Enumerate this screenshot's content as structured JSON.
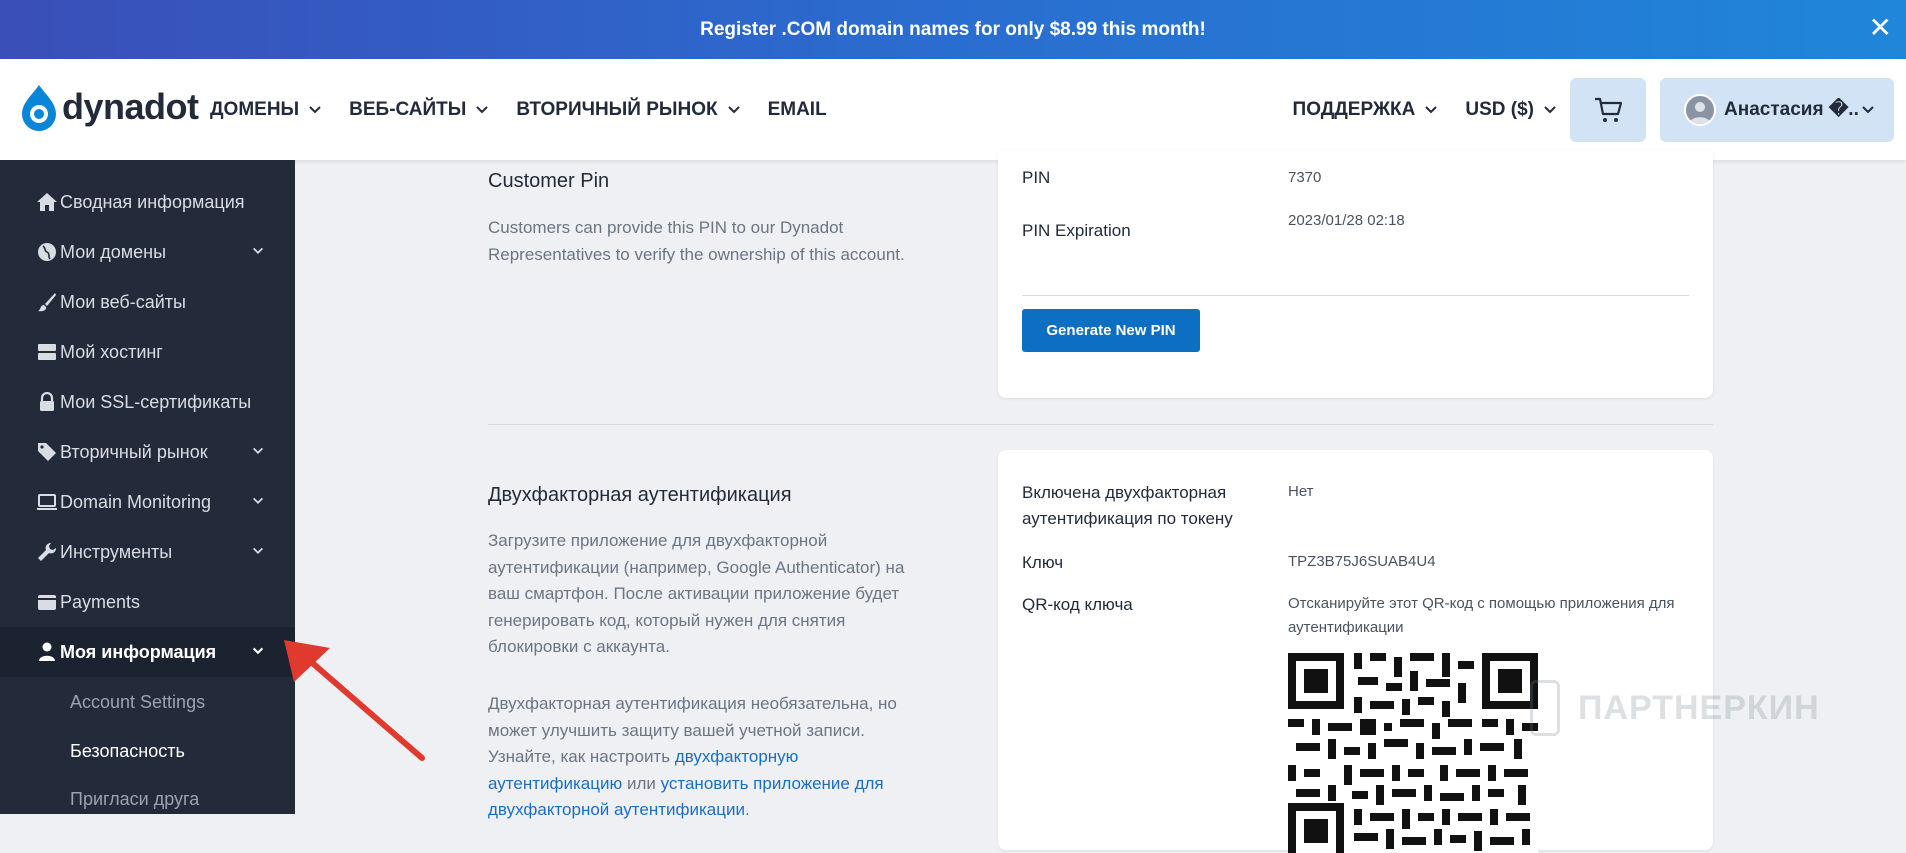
{
  "promo": {
    "text": "Register .COM domain names for only $8.99 this month!",
    "close": "✕"
  },
  "logo": {
    "text": "dynadot",
    "color": "#0a86d8"
  },
  "nav": {
    "items": [
      {
        "label": "ДОМЕНЫ",
        "dropdown": true
      },
      {
        "label": "ВЕБ-САЙТЫ",
        "dropdown": true
      },
      {
        "label": "ВТОРИЧНЫЙ РЫНОК",
        "dropdown": true
      },
      {
        "label": "EMAIL",
        "dropdown": false
      }
    ],
    "support": "ПОДДЕРЖКА",
    "currency": "USD ($)",
    "user": "Анастасия �..."
  },
  "sidebar": {
    "items": [
      {
        "label": "Сводная информация",
        "icon": "home-icon"
      },
      {
        "label": "Мои домены",
        "icon": "globe-icon"
      },
      {
        "label": "Мои веб-сайты",
        "icon": "brush-icon"
      },
      {
        "label": "Мой хостинг",
        "icon": "server-icon"
      },
      {
        "label": "Мои SSL-сертификаты",
        "icon": "lock-icon"
      },
      {
        "label": "Вторичный рынок",
        "icon": "tag-icon"
      },
      {
        "label": "Domain Monitoring",
        "icon": "laptop-icon"
      },
      {
        "label": "Инструменты",
        "icon": "wrench-icon"
      },
      {
        "label": "Payments",
        "icon": "wallet-icon"
      },
      {
        "label": "Моя информация",
        "icon": "user-icon"
      }
    ],
    "sub": [
      "Account Settings",
      "Безопасность",
      "Пригласи друга"
    ]
  },
  "pin": {
    "title": "Customer Pin",
    "desc": "Customers can provide this PIN to our Dynadot Representatives to verify the ownership of this account.",
    "pin_label": "PIN",
    "pin_value": "7370",
    "exp_label": "PIN Expiration",
    "exp_value": "2023/01/28 02:18",
    "button": "Generate New PIN"
  },
  "twofa": {
    "title": "Двухфакторная аутентификация",
    "desc1": "Загрузите приложение для двухфакторной аутентификации (например, Google Authenticator) на ваш смартфон. После активации приложение будет генерировать код, который нужен для снятия блокировки с аккаунта.",
    "desc2_a": "Двухфакторная аутентификация необязательна, но может улучшить защиту вашей учетной записи. Узнайте, как настроить ",
    "desc2_link1": "двухфакторную аутентификацию",
    "desc2_b": " или ",
    "desc2_link2": "установить приложение для двухфакторной аутентификации",
    "desc2_c": ".",
    "enabled_label": "Включена двухфакторная аутентификация по токену",
    "enabled_value": "Нет",
    "key_label": "Ключ",
    "key_value": "TPZ3B75J6SUAB4U4",
    "qr_label": "QR-код ключа",
    "qr_value": "Отсканируйте этот QR-код с помощью приложения для аутентификации"
  },
  "watermark": "ПАРТНЕРКИН"
}
